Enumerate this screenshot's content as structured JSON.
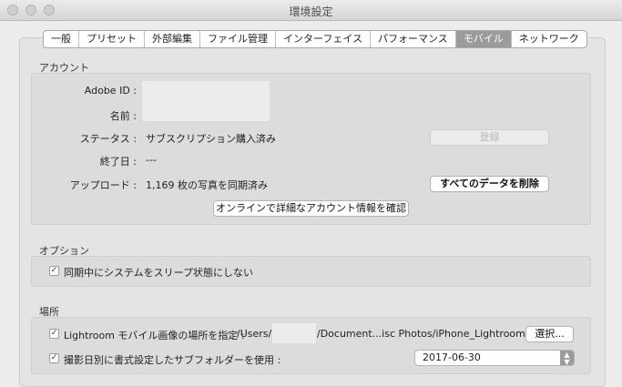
{
  "window": {
    "title": "環境設定"
  },
  "tabs": [
    "一般",
    "プリセット",
    "外部編集",
    "ファイル管理",
    "インターフェイス",
    "パフォーマンス",
    "モバイル",
    "ネットワーク"
  ],
  "active_tab": "モバイル",
  "account": {
    "section_title": "アカウント",
    "adobe_id_label": "Adobe ID :",
    "name_label": "名前 :",
    "status_label": "ステータス :",
    "status_value": "サブスクリプション購入済み",
    "end_date_label": "終了日 :",
    "end_date_value": "---",
    "upload_label": "アップロード :",
    "upload_value": "1,169 枚の写真を同期済み",
    "register_button": "登録",
    "delete_all_button": "すべてのデータを削除",
    "online_button": "オンラインで詳細なアカウント情報を確認"
  },
  "options": {
    "section_title": "オプション",
    "no_sleep_label": "同期中にシステムをスリープ状態にしない",
    "no_sleep_checked": true
  },
  "location": {
    "section_title": "場所",
    "specify_label": "Lightroom モバイル画像の場所を指定 :",
    "path_prefix": "/Users/",
    "path_suffix": "/Document...isc Photos/iPhone_Lightroom",
    "specify_checked": true,
    "choose_button": "選択...",
    "subfolder_label": "撮影日別に書式設定したサブフォルダーを使用 :",
    "subfolder_checked": true,
    "subfolder_format": "2017-06-30"
  },
  "icons": {
    "check": "checkmark-icon",
    "select_arrows": "up-down-arrows-icon"
  }
}
